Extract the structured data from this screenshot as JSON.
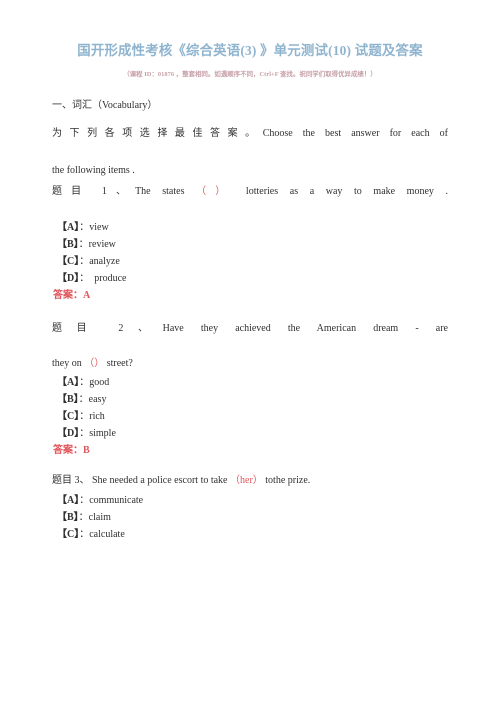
{
  "document": {
    "title": "国开形成性考核《综合英语(3) 》单元测试(10) 试题及答案",
    "subtitle": "（课程 ID：01876 ，整套相同。如遇顺序不同，Ctrl+F 查找。祝同学们取得优异成绩！）",
    "section_heading": "一、词汇（Vocabulary）",
    "instruction_cn": "为下列各项选择最佳答案。",
    "instruction_en": "Choose the best answer for each of",
    "instruction_en_line2": "the following  items .",
    "answer_label": "答案：",
    "colors": {
      "title": "#8fb4cf",
      "subtitle": "#c7a0a8",
      "body": "#303030",
      "answer": "#e0565c",
      "blank": "#e0565c",
      "background": "#ffffff"
    }
  },
  "questions": [
    {
      "number": "题目 1、",
      "stem_before": "The  states ",
      "blank": "（）",
      "stem_after": "  lotteries  as  a  way  to  make  money .",
      "stem_full": "题目 1、The  states （）  lotteries  as  a  way  to  make  money .",
      "options": [
        {
          "tag": "【A】",
          "sep": "：",
          "text": "view"
        },
        {
          "tag": "【B】",
          "sep": "：",
          "text": "review"
        },
        {
          "tag": "【C】",
          "sep": "：",
          "text": "analyze"
        },
        {
          "tag": "【D】",
          "sep": "：",
          "text": "  produce"
        }
      ],
      "answer": "A"
    },
    {
      "number": "题目 2、",
      "stem_line1": "题目 2、Have  they  achieved  the  American  dream - are",
      "stem_line2_before": "they  on ",
      "blank": "（）",
      "stem_line2_after": "  street?",
      "options": [
        {
          "tag": "【A】",
          "sep": "：",
          "text": "good"
        },
        {
          "tag": "【B】",
          "sep": "：",
          "text": "easy"
        },
        {
          "tag": "【C】",
          "sep": "：",
          "text": "rich"
        },
        {
          "tag": "【D】",
          "sep": "：",
          "text": "simple"
        }
      ],
      "answer": "B"
    },
    {
      "number": "题目 3、",
      "stem_before": "题目 3、  She  needed  a  police  escort  to  take  ",
      "blank": "（her）",
      "stem_after": "  tothe  prize.",
      "options": [
        {
          "tag": "【A】",
          "sep": "：",
          "text": "communicate"
        },
        {
          "tag": "【B】",
          "sep": "：",
          "text": "claim"
        },
        {
          "tag": "【C】",
          "sep": "：",
          "text": "calculate"
        }
      ],
      "answer": ""
    }
  ]
}
